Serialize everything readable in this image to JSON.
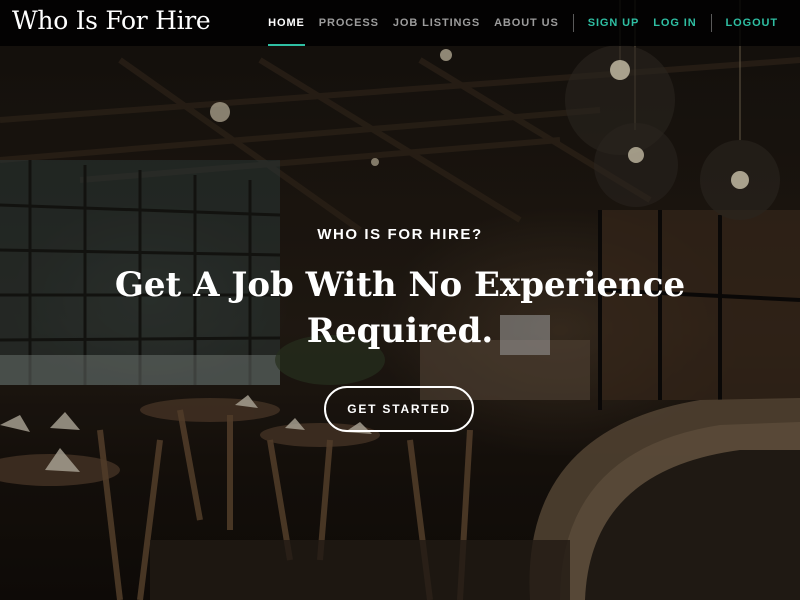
{
  "brand": {
    "name": "Who Is For Hire"
  },
  "nav": {
    "items": [
      {
        "label": "HOME",
        "active": true
      },
      {
        "label": "PROCESS",
        "active": false
      },
      {
        "label": "JOB LISTINGS",
        "active": false
      },
      {
        "label": "ABOUT US",
        "active": false
      }
    ],
    "account": [
      {
        "label": "SIGN UP"
      },
      {
        "label": "LOG IN"
      }
    ],
    "logout": {
      "label": "LOGOUT"
    }
  },
  "hero": {
    "eyebrow": "WHO IS FOR HIRE?",
    "headline": "Get A Job With No Experience Required.",
    "cta_label": "GET STARTED"
  },
  "colors": {
    "accent": "#2fbfa3",
    "nav_background": "#000000",
    "nav_inactive": "#9c9c9c",
    "text": "#ffffff"
  },
  "background": {
    "description_icon": "restaurant-interior-image"
  }
}
